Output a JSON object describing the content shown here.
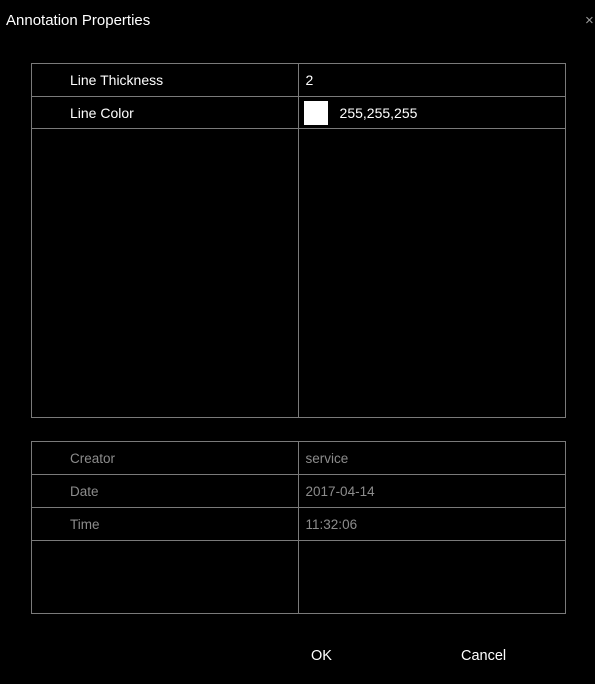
{
  "window": {
    "title": "Annotation Properties",
    "close_glyph": "×"
  },
  "properties": [
    {
      "label": "Line Thickness",
      "value": "2"
    },
    {
      "label": "Line Color",
      "value": "255,255,255",
      "swatch_color": "#ffffff"
    }
  ],
  "info": [
    {
      "label": "Creator",
      "value": "service"
    },
    {
      "label": "Date",
      "value": "2017-04-14"
    },
    {
      "label": "Time",
      "value": "11:32:06"
    }
  ],
  "buttons": {
    "ok": "OK",
    "cancel": "Cancel"
  },
  "colors": {
    "background": "#000000",
    "grid_line": "#7a7a7a",
    "text": "#ffffff",
    "disabled_text": "#8c8c8c"
  }
}
